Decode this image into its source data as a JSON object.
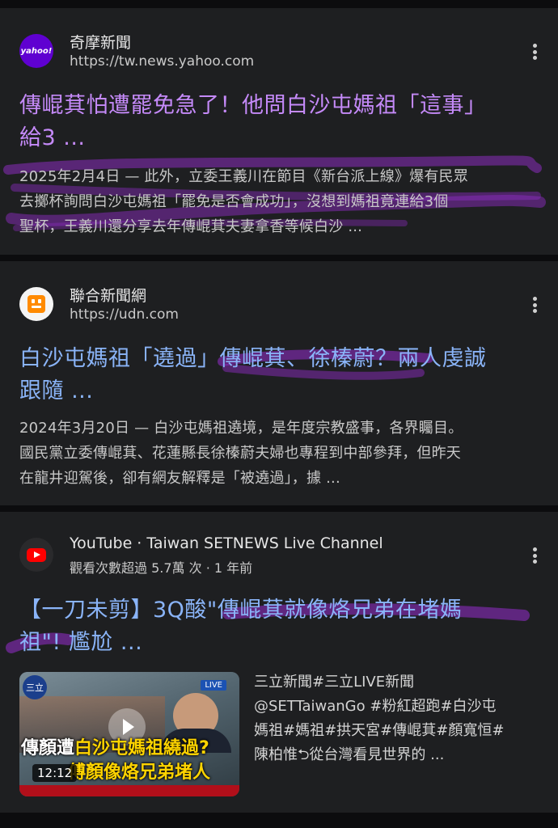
{
  "results": [
    {
      "source_name": "奇摩新聞",
      "source_url": "https://tw.news.yahoo.com",
      "favicon_label": "yahoo!",
      "title_line1": "傳崐萁怕遭罷免急了！他問白沙屯媽祖「這事」",
      "title_line2": "給3 ...",
      "snippet_lines": [
        "2025年2月4日 — 此外，立委王義川在節目《新台派上線》爆有民眾",
        "去擲杯詢問白沙屯媽祖「罷免是否會成功」，沒想到媽祖竟連給3個",
        "聖杯，王義川還分享去年傳崐萁夫妻拿香等候白沙 ..."
      ]
    },
    {
      "source_name": "聯合新聞網",
      "source_url": "https://udn.com",
      "title_line1": "白沙屯媽祖「遶過」傳崐萁、徐榛蔚？兩人虔誠",
      "title_line2": "跟隨 ...",
      "snippet_lines": [
        "2024年3月20日 — 白沙屯媽祖遶境，是年度宗教盛事，各界矚目。",
        "國民黨立委傳崐萁、花蓮縣長徐榛蔚夫婦也專程到中部參拜，但昨天",
        "在龍井迎駕後，卻有網友解釋是「被遶過」，據 ..."
      ]
    },
    {
      "source_name": "YouTube · Taiwan SETNEWS Live Channel",
      "meta": "觀看次數超過 5.7萬 次 · 1 年前",
      "title_line1": "【一刀未剪】3Q酸\"傳崐萁就像烙兄弟在堵媽",
      "title_line2": "祖\"! 尷尬 ...",
      "thumbnail": {
        "duration": "12:12",
        "caption_line1_prefix": "傳顏遭",
        "caption_line1_hl": "白沙屯媽祖繞過?",
        "caption_line2": "傅顏像烙兄弟堵人",
        "live_badge": "LIVE",
        "logo_text": "三立"
      },
      "desc_lines": [
        "三立新聞#三立LIVE新聞",
        "@SETTaiwanGo #粉紅超跑#白沙屯",
        "媽祖#媽祖#拱天宮#傳崐萁#顏寬恒#",
        "陳柏惟⮌從台灣看見世界的 ..."
      ]
    }
  ],
  "colors": {
    "visited_title": "#c58af9",
    "title_blue": "#8ab4f8",
    "highlight_purple": "#8a2bbe"
  }
}
